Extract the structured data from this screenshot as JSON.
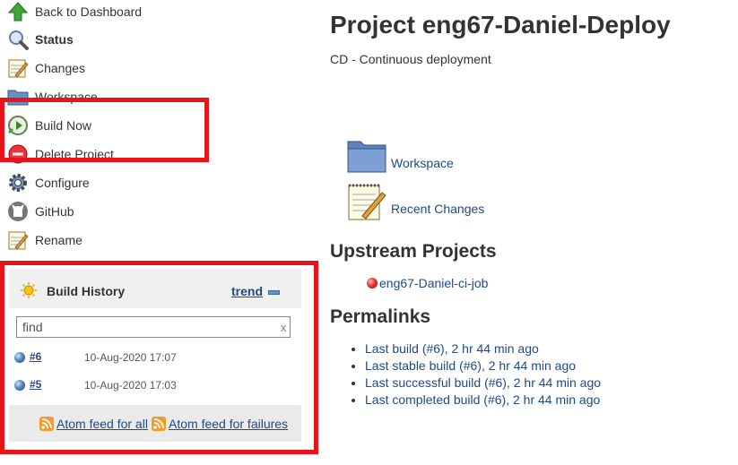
{
  "sidebar": {
    "tasks": [
      {
        "label": "Back to Dashboard",
        "icon": "up-arrow-icon"
      },
      {
        "label": "Status",
        "icon": "magnifier-icon"
      },
      {
        "label": "Changes",
        "icon": "notepad-icon"
      },
      {
        "label": "Workspace",
        "icon": "folder-icon"
      },
      {
        "label": "Build Now",
        "icon": "clock-play-icon"
      },
      {
        "label": "Delete Project",
        "icon": "delete-icon"
      },
      {
        "label": "Configure",
        "icon": "gear-icon"
      },
      {
        "label": "GitHub",
        "icon": "github-icon"
      },
      {
        "label": "Rename",
        "icon": "notepad-icon"
      }
    ]
  },
  "build_history": {
    "title": "Build History",
    "trend_label": "trend",
    "search_value": "find",
    "clear_label": "x",
    "builds": [
      {
        "number": "#6",
        "date": "10-Aug-2020 17:07",
        "status_color": "#3f68a8"
      },
      {
        "number": "#5",
        "date": "10-Aug-2020 17:03",
        "status_color": "#3f68a8"
      }
    ],
    "feed_all": "Atom feed for all",
    "feed_failures": "Atom feed for failures"
  },
  "main": {
    "title": "Project eng67-Daniel-Deploy",
    "description": "CD - Continuous deployment",
    "workspace_link": "Workspace",
    "recent_changes_link": "Recent Changes",
    "upstream_heading": "Upstream Projects",
    "upstream_project": "eng67-Daniel-ci-job",
    "permalinks_heading": "Permalinks",
    "permalinks": [
      "Last build (#6), 2 hr 44 min ago",
      "Last stable build (#6), 2 hr 44 min ago",
      "Last successful build (#6), 2 hr 44 min ago",
      "Last completed build (#6), 2 hr 44 min ago"
    ]
  },
  "colors": {
    "highlight_border": "#e8131b",
    "link": "#204a87",
    "panel_bg": "#f0f0f0",
    "rss_orange": "#f39a2b"
  }
}
